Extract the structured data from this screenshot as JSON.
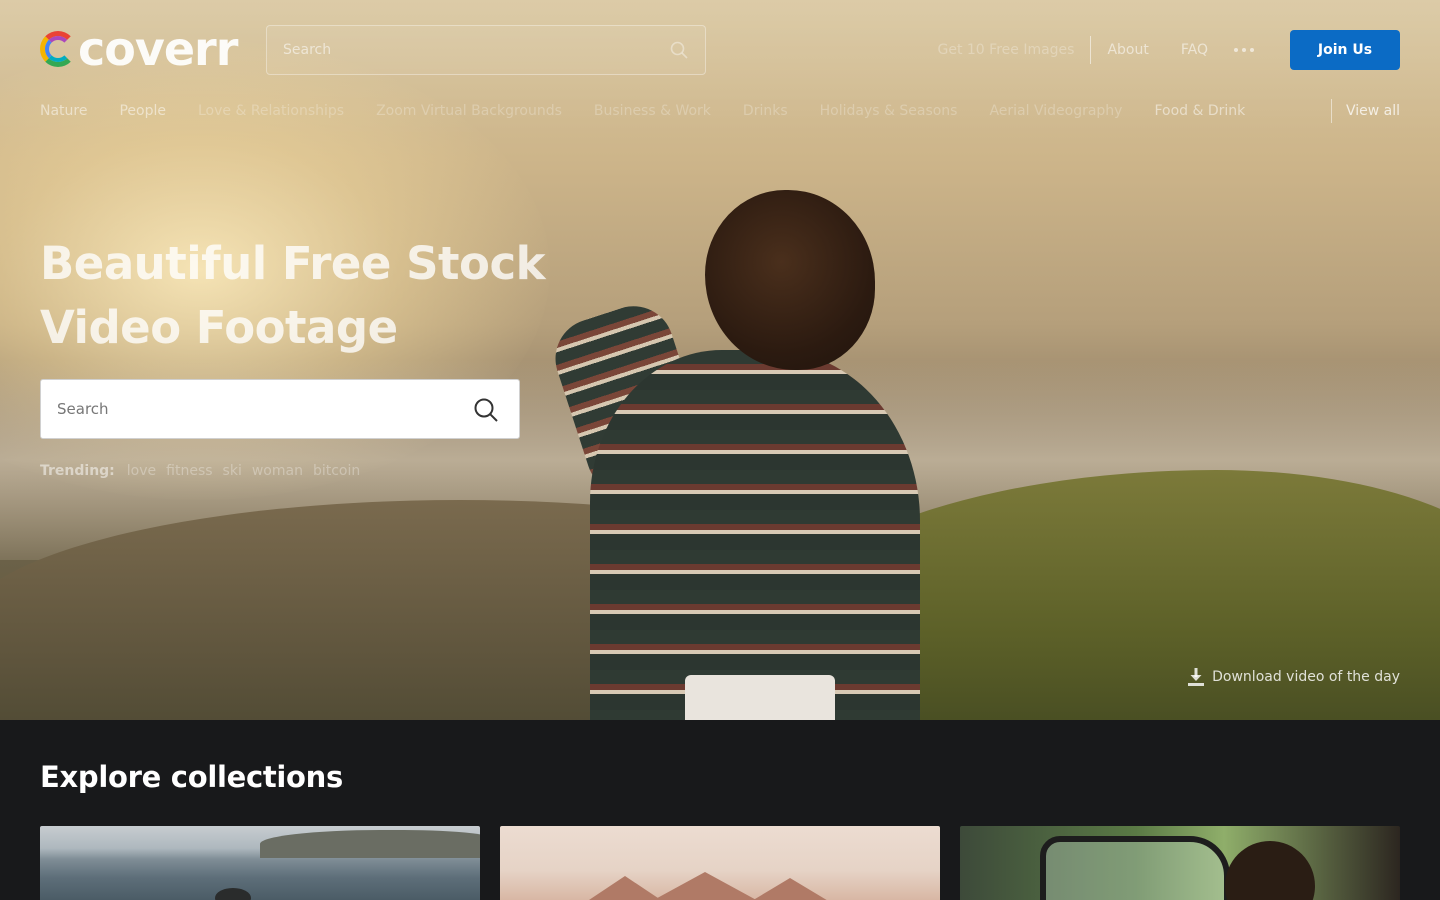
{
  "brand": {
    "logo_text": "coverr"
  },
  "header": {
    "search_placeholder": "Search",
    "nav": {
      "free_images": "Get 10 Free Images",
      "about": "About",
      "faq": "FAQ",
      "join": "Join Us"
    }
  },
  "categories": {
    "items": [
      "Nature",
      "People",
      "Love & Relationships",
      "Zoom Virtual Backgrounds",
      "Business & Work",
      "Drinks",
      "Holidays & Seasons",
      "Aerial Videography",
      "Food & Drink"
    ],
    "view_all": "View all"
  },
  "hero": {
    "title_line1": "Beautiful Free Stock",
    "title_line2": "Video Footage",
    "search_placeholder": "Search",
    "trending_label": "Trending:",
    "trending": [
      "love",
      "fitness",
      "ski",
      "woman",
      "bitcoin"
    ],
    "download_label": "Download video of the day"
  },
  "explore": {
    "title": "Explore collections"
  },
  "colors": {
    "accent": "#0b6bc5",
    "page_bg": "#18191b"
  }
}
